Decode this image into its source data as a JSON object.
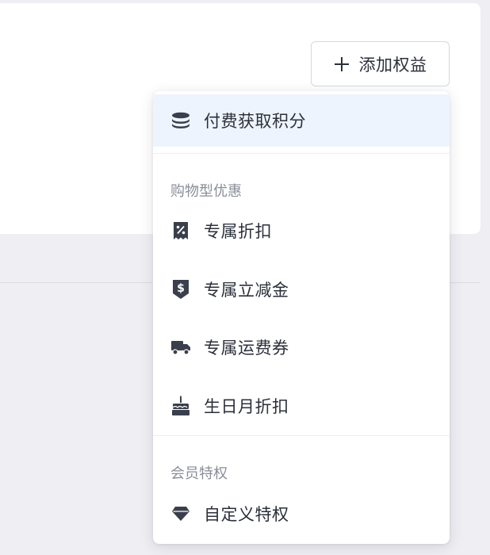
{
  "toolbar": {
    "add_benefit_label": "添加权益"
  },
  "menu": {
    "top_item": {
      "label": "付费获取积分",
      "icon": "coins-stack-icon"
    },
    "groups": [
      {
        "title": "购物型优惠",
        "items": [
          {
            "label": "专属折扣",
            "icon": "percent-receipt-icon"
          },
          {
            "label": "专属立减金",
            "icon": "dollar-tag-icon"
          },
          {
            "label": "专属运费券",
            "icon": "delivery-truck-icon"
          },
          {
            "label": "生日月折扣",
            "icon": "birthday-cake-icon"
          }
        ]
      },
      {
        "title": "会员特权",
        "items": [
          {
            "label": "自定义特权",
            "icon": "gem-icon"
          }
        ]
      }
    ]
  },
  "colors": {
    "accent_bg": "#eef4fd",
    "icon": "#3a3f4c",
    "page_bg": "#eeeef3"
  }
}
